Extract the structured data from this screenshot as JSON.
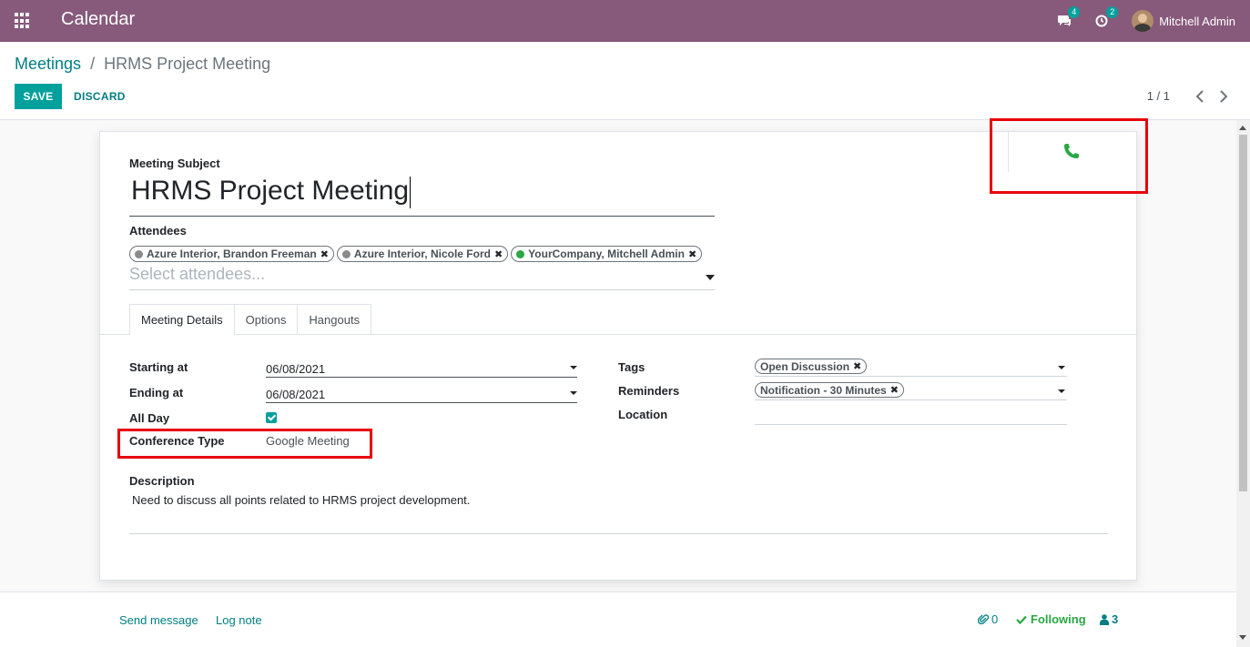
{
  "navbar": {
    "app_title": "Calendar",
    "messages_count": "4",
    "activities_count": "2",
    "user_name": "Mitchell Admin"
  },
  "breadcrumb": {
    "parent": "Meetings",
    "separator": "/",
    "current": "HRMS Project Meeting"
  },
  "toolbar": {
    "save_label": "SAVE",
    "discard_label": "DISCARD"
  },
  "pager": {
    "value": "1 / 1",
    "prev_icon": "chevron-left-icon",
    "next_icon": "chevron-right-icon"
  },
  "form": {
    "subject_label": "Meeting Subject",
    "subject_value": "HRMS Project Meeting",
    "attendees_label": "Attendees",
    "attendees": [
      {
        "label": "Azure Interior, Brandon Freeman",
        "status_color": "#8a8a8a"
      },
      {
        "label": "Azure Interior, Nicole Ford",
        "status_color": "#8a8a8a"
      },
      {
        "label": "YourCompany, Mitchell Admin",
        "status_color": "#28a745"
      }
    ],
    "attendees_placeholder": "Select attendees...",
    "tabs": [
      {
        "label": "Meeting Details",
        "active": true
      },
      {
        "label": "Options",
        "active": false
      },
      {
        "label": "Hangouts",
        "active": false
      }
    ],
    "details": {
      "starting_label": "Starting at",
      "starting_value": "06/08/2021",
      "ending_label": "Ending at",
      "ending_value": "06/08/2021",
      "allday_label": "All Day",
      "allday_checked": true,
      "conference_label": "Conference Type",
      "conference_value": "Google Meeting",
      "tags_label": "Tags",
      "tags": [
        "Open Discussion"
      ],
      "reminders_label": "Reminders",
      "reminders": [
        "Notification - 30 Minutes"
      ],
      "location_label": "Location",
      "location_value": ""
    },
    "description_label": "Description",
    "description_value": "Need to discuss all points related to HRMS project development."
  },
  "smart_button": {
    "icon": "phone-icon",
    "color": "#28a745"
  },
  "chatter": {
    "send_message": "Send message",
    "log_note": "Log note",
    "attachments_count": "0",
    "following_label": "Following",
    "followers_count": "3"
  },
  "colors": {
    "brand": "#875a7b",
    "accent": "#00a09d",
    "link": "#017e84",
    "highlight": "#e8000b"
  }
}
